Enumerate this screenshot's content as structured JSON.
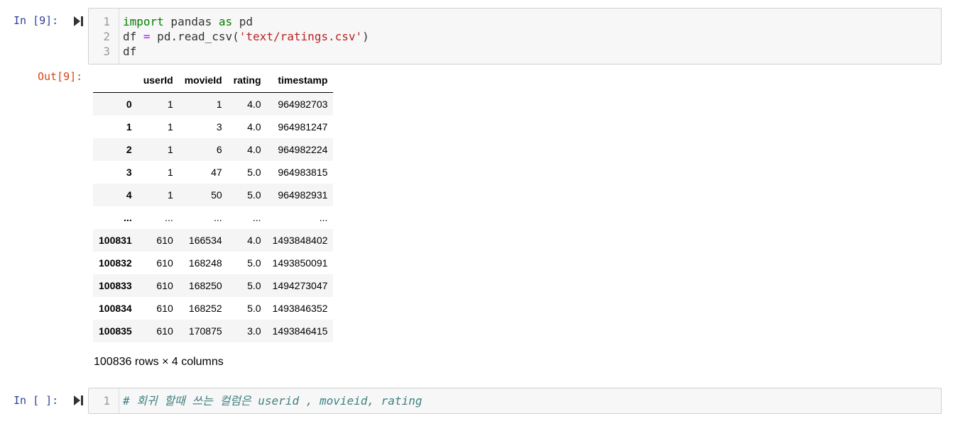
{
  "cells": [
    {
      "prompt": "In [9]:",
      "code_lines": [
        {
          "num": "1",
          "tokens": [
            {
              "t": "import",
              "c": "kw"
            },
            {
              "t": " pandas ",
              "c": ""
            },
            {
              "t": "as",
              "c": "kw"
            },
            {
              "t": " pd",
              "c": ""
            }
          ]
        },
        {
          "num": "2",
          "tokens": [
            {
              "t": "df ",
              "c": ""
            },
            {
              "t": "=",
              "c": "op"
            },
            {
              "t": " pd.read_csv(",
              "c": ""
            },
            {
              "t": "'text/ratings.csv'",
              "c": "str"
            },
            {
              "t": ")",
              "c": ""
            }
          ]
        },
        {
          "num": "3",
          "tokens": [
            {
              "t": "df",
              "c": ""
            }
          ]
        }
      ]
    },
    {
      "prompt": "In [ ]:",
      "code_lines": [
        {
          "num": "1",
          "tokens": [
            {
              "t": "# 회귀 할때 쓰는 컬럼은 userid , movieid, rating",
              "c": "cm"
            }
          ]
        }
      ]
    }
  ],
  "output": {
    "prompt": "Out[9]:",
    "columns": [
      "",
      "userId",
      "movieId",
      "rating",
      "timestamp"
    ],
    "rows": [
      [
        "0",
        "1",
        "1",
        "4.0",
        "964982703"
      ],
      [
        "1",
        "1",
        "3",
        "4.0",
        "964981247"
      ],
      [
        "2",
        "1",
        "6",
        "4.0",
        "964982224"
      ],
      [
        "3",
        "1",
        "47",
        "5.0",
        "964983815"
      ],
      [
        "4",
        "1",
        "50",
        "5.0",
        "964982931"
      ],
      [
        "...",
        "...",
        "...",
        "...",
        "..."
      ],
      [
        "100831",
        "610",
        "166534",
        "4.0",
        "1493848402"
      ],
      [
        "100832",
        "610",
        "168248",
        "5.0",
        "1493850091"
      ],
      [
        "100833",
        "610",
        "168250",
        "5.0",
        "1494273047"
      ],
      [
        "100834",
        "610",
        "168252",
        "5.0",
        "1493846352"
      ],
      [
        "100835",
        "610",
        "170875",
        "3.0",
        "1493846415"
      ]
    ],
    "shape_text": "100836 rows × 4 columns"
  },
  "colors": {
    "prompt_in": "#303f9f",
    "prompt_out": "#d84315",
    "keyword": "#008000",
    "operator": "#aa22ff",
    "string": "#ba2121",
    "comment": "#408080"
  },
  "icons": {
    "run": "run-cell-icon"
  }
}
